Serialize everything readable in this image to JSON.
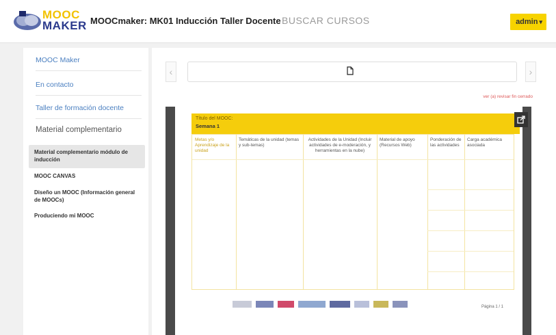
{
  "header": {
    "logo": {
      "line1": "MOOC",
      "line2": "MAKER"
    },
    "course_title": "MOOCmaker: MK01 Inducción Taller Docente",
    "search_link": "BUSCAR CURSOS",
    "user_menu": "admin"
  },
  "sidebar": {
    "links": [
      "MOOC Maker",
      "En contacto",
      "Taller de formación docente"
    ],
    "section": "Material complementario",
    "active_item": "Material complementario módulo de inducción",
    "items": [
      "MOOC CANVAS",
      "Diseño un MOOC (Información general de MOOCs)",
      "Produciendo mi MOOC"
    ]
  },
  "viewer": {
    "download_link": "ver (a) revisar fin cerrado",
    "page_label": "Página 1 / 1"
  },
  "doc": {
    "head_title": "Título del MOOC:",
    "head_week": "Semana 1",
    "columns": [
      "Metas y/o Aprendizaje de la unidad",
      "Temáticas de la unidad (temas y sub-temas)",
      "Actividades de la Unidad (Incluir actividades de e-moderación, y herramientas en la nube)",
      "Material de apoyo (Recursos Web)",
      "Ponderación de las actividades",
      "Carga académica asociada"
    ]
  },
  "colors": {
    "accent": "#f7d300",
    "link": "#4a7fc0",
    "brand_blue": "#2b3a8c"
  }
}
